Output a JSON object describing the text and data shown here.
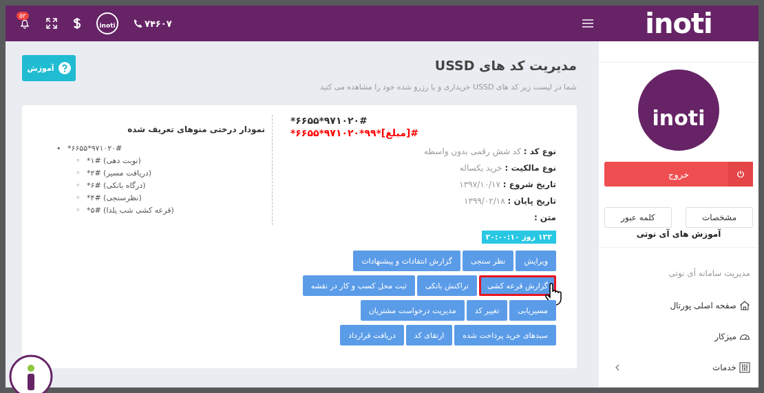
{
  "header": {
    "notification_count": "۵۳",
    "logo_text": "inoti",
    "phone": "۷۴۶۰۷",
    "brand": "inoti"
  },
  "page": {
    "title": "مدیریت کد های USSD",
    "subtitle": "شما در لیست زیر کد های USSD خریداری و یا رزرو شده خود را مشاهده می کنید",
    "help_button": "آموزش"
  },
  "code_card": {
    "code": "*۶۶۵۵*۹۷۱۰۲۰#",
    "payment_code": "*۶۶۵۵*۹۷۱۰۲۰*۹۹*[مبلغ]#",
    "details": [
      {
        "label": "نوع کد :",
        "value": "کد شش رقمی بدون واسطه"
      },
      {
        "label": "نوع مالکیت :",
        "value": "خرید یکساله"
      },
      {
        "label": "تاریخ شروع :",
        "value": "۱۳۹۷/۱۰/۱۷"
      },
      {
        "label": "تاریخ پایان :",
        "value": "۱۳۹۹/۰۲/۱۸"
      },
      {
        "label": "متن :"
      }
    ],
    "timer": "۱۲۲ روز ۲۰:۰۰:۱۰",
    "action_rows": [
      [
        {
          "label": "ویرایش",
          "selected": false
        },
        {
          "label": "نظر سنجی",
          "selected": false
        },
        {
          "label": "گزارش انتقادات و پیشنهادات",
          "selected": false
        }
      ],
      [
        {
          "label": "گزارش قرعه کشی",
          "selected": true
        },
        {
          "label": "تراکنش بانکی",
          "selected": false
        },
        {
          "label": "ثبت محل کسب و کار در نقشه",
          "selected": false
        }
      ],
      [
        {
          "label": "مسیریابی",
          "selected": false
        },
        {
          "label": "تغییر کد",
          "selected": false
        },
        {
          "label": "مدیریت درخواست مشتریان",
          "selected": false
        }
      ],
      [
        {
          "label": "سبدهای خرید پرداخت شده",
          "selected": false
        },
        {
          "label": "ارتقای کد",
          "selected": false
        },
        {
          "label": "دریافت قرارداد",
          "selected": false
        }
      ]
    ]
  },
  "menu_tree": {
    "title": "نمودار درختی منوهای تعریف شده",
    "root": {
      "marker": "•",
      "text": "*۶۶۵۵*۹۷۱۰۲۰#"
    },
    "children": [
      {
        "marker": "◦",
        "text": "*۱# (نوبت دهی)"
      },
      {
        "marker": "◦",
        "text": "*۲# (دریافت مسیر)"
      },
      {
        "marker": "◦",
        "text": "*۶# (درگاه بانکی)"
      },
      {
        "marker": "◦",
        "text": "*۴# (نظرسنجی)"
      },
      {
        "marker": "◦",
        "text": "*۵# (قرعه کشی شب یلدا)"
      }
    ]
  },
  "sidebar": {
    "logo_text": "inoti",
    "logout_button": "خروج",
    "buttons": [
      "مشخصات",
      "کلمه عبور"
    ],
    "tutorials_link": "آموزش های آی نوتی",
    "section_title": "مدیریت سامانه آی نوتی",
    "items": [
      {
        "kind": "home",
        "label": "صفحه اصلی پورتال"
      },
      {
        "kind": "dashboard",
        "label": "میزکار"
      },
      {
        "kind": "services",
        "label": "خدمات",
        "expandable": true
      }
    ]
  }
}
